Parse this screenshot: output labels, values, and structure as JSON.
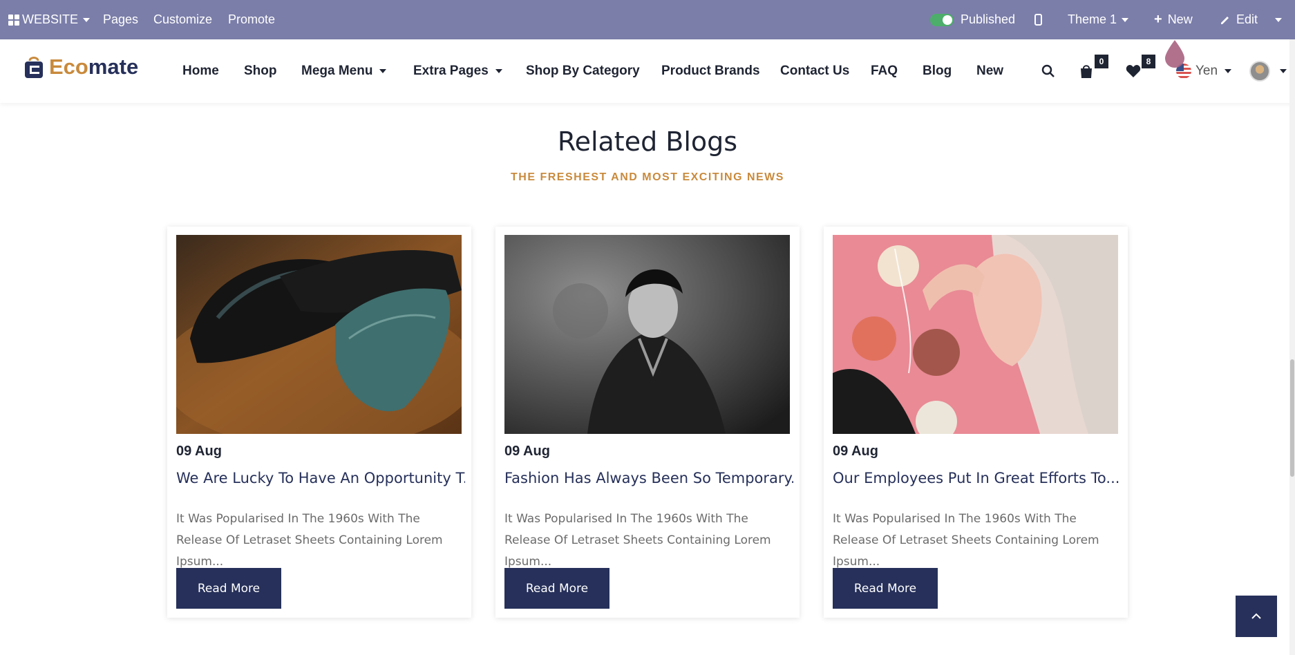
{
  "admin_bar": {
    "website_label": "WEBSITE",
    "pages_label": "Pages",
    "customize_label": "Customize",
    "promote_label": "Promote",
    "published_label": "Published",
    "theme_label": "Theme 1",
    "new_label": "New",
    "edit_label": "Edit",
    "bg_color": "#7b7ea9"
  },
  "header": {
    "logo_eco": "Eco",
    "logo_mate": "mate",
    "nav": [
      "Home",
      "Shop",
      "Mega Menu",
      "Extra Pages",
      "Shop By Category",
      "Product Brands",
      "Contact Us",
      "FAQ",
      "Blog",
      "New"
    ],
    "cart_count": "0",
    "wishlist_count": "8",
    "currency": "Yen",
    "icons": [
      "search-icon",
      "shopping-bag-icon",
      "heart-icon",
      "us-flag-icon",
      "avatar"
    ]
  },
  "section": {
    "title": "Related Blogs",
    "subtitle": "THE FRESHEST AND MOST EXCITING NEWS"
  },
  "blogs": [
    {
      "date": "09 Aug",
      "title": "We Are Lucky To Have An Opportunity T...",
      "excerpt": "It Was Popularised In The 1960s With The Release Of Letraset Sheets Containing Lorem Ipsum...",
      "button": "Read More",
      "image": "shoes-and-tie-photo"
    },
    {
      "date": "09 Aug",
      "title": "Fashion Has Always Been So Temporary...",
      "excerpt": "It Was Popularised In The 1960s With The Release Of Letraset Sheets Containing Lorem Ipsum...",
      "button": "Read More",
      "image": "man-in-coat-photo"
    },
    {
      "date": "09 Aug",
      "title": "Our Employees Put In Great Efforts To...",
      "excerpt": "It Was Popularised In The 1960s With The Release Of Letraset Sheets Containing Lorem Ipsum...",
      "button": "Read More",
      "image": "woman-with-headphones-photo"
    }
  ],
  "colors": {
    "accent": "#c98a3c",
    "navy": "#26305a"
  }
}
